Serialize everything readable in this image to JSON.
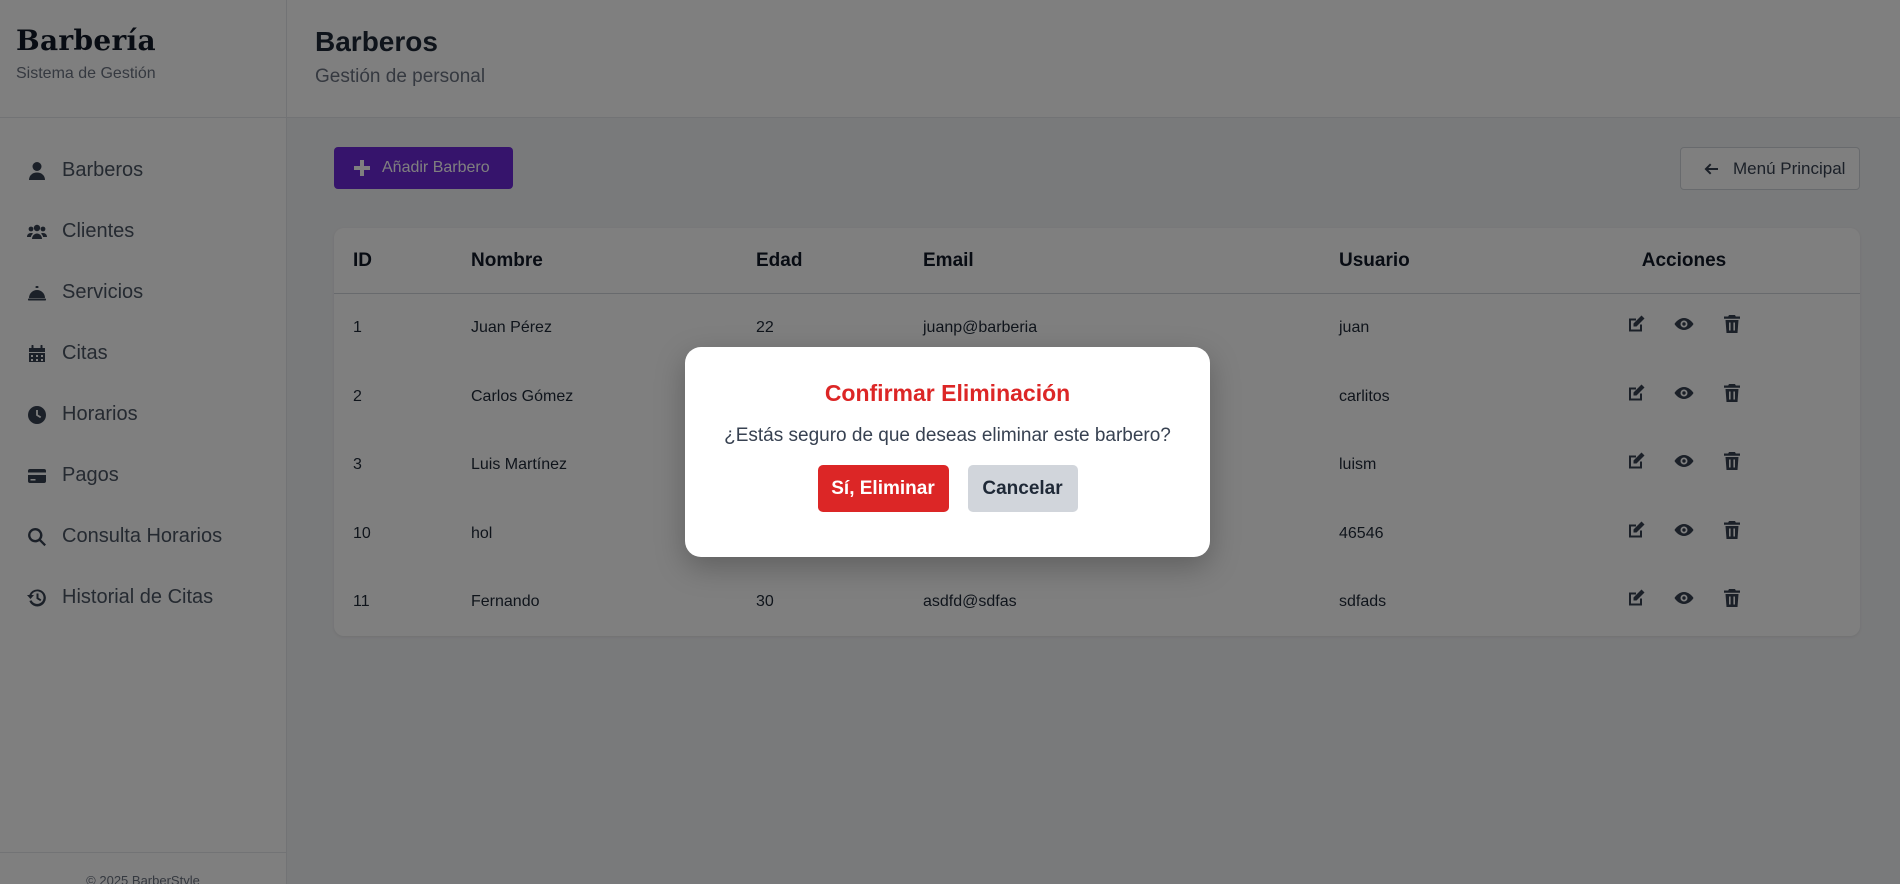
{
  "sidebar": {
    "brand_title": "Barbería",
    "brand_subtitle": "Sistema de Gestión",
    "items": [
      {
        "label": "Barberos",
        "icon": "user-icon"
      },
      {
        "label": "Clientes",
        "icon": "users-icon"
      },
      {
        "label": "Servicios",
        "icon": "bell-concierge-icon"
      },
      {
        "label": "Citas",
        "icon": "calendar-icon"
      },
      {
        "label": "Horarios",
        "icon": "clock-icon"
      },
      {
        "label": "Pagos",
        "icon": "credit-card-icon"
      },
      {
        "label": "Consulta Horarios",
        "icon": "search-icon"
      },
      {
        "label": "Historial de Citas",
        "icon": "history-icon"
      }
    ],
    "footer": "© 2025 BarberStyle"
  },
  "header": {
    "title": "Barberos",
    "subtitle": "Gestión de personal"
  },
  "toolbar": {
    "add_label": "Añadir Barbero",
    "menu_label": "Menú Principal"
  },
  "table": {
    "columns": [
      "ID",
      "Nombre",
      "Edad",
      "Email",
      "Usuario",
      "Acciones"
    ],
    "rows": [
      {
        "id": "1",
        "nombre": "Juan Pérez",
        "edad": "22",
        "email": "juanp@barberia",
        "usuario": "juan"
      },
      {
        "id": "2",
        "nombre": "Carlos Gómez",
        "edad": "",
        "email": "",
        "usuario": "carlitos"
      },
      {
        "id": "3",
        "nombre": "Luis Martínez",
        "edad": "",
        "email": "",
        "usuario": "luism"
      },
      {
        "id": "10",
        "nombre": "hol",
        "edad": "",
        "email": "",
        "usuario": "46546"
      },
      {
        "id": "11",
        "nombre": "Fernando",
        "edad": "30",
        "email": "asdfd@sdfas",
        "usuario": "sdfads"
      }
    ]
  },
  "modal": {
    "title": "Confirmar Eliminación",
    "message": "¿Estás seguro de que deseas eliminar este barbero?",
    "confirm_label": "Sí, Eliminar",
    "cancel_label": "Cancelar"
  },
  "colors": {
    "accent": "#6d28d9",
    "danger": "#dc2626",
    "overlay": "rgba(0,0,0,0.5)"
  }
}
